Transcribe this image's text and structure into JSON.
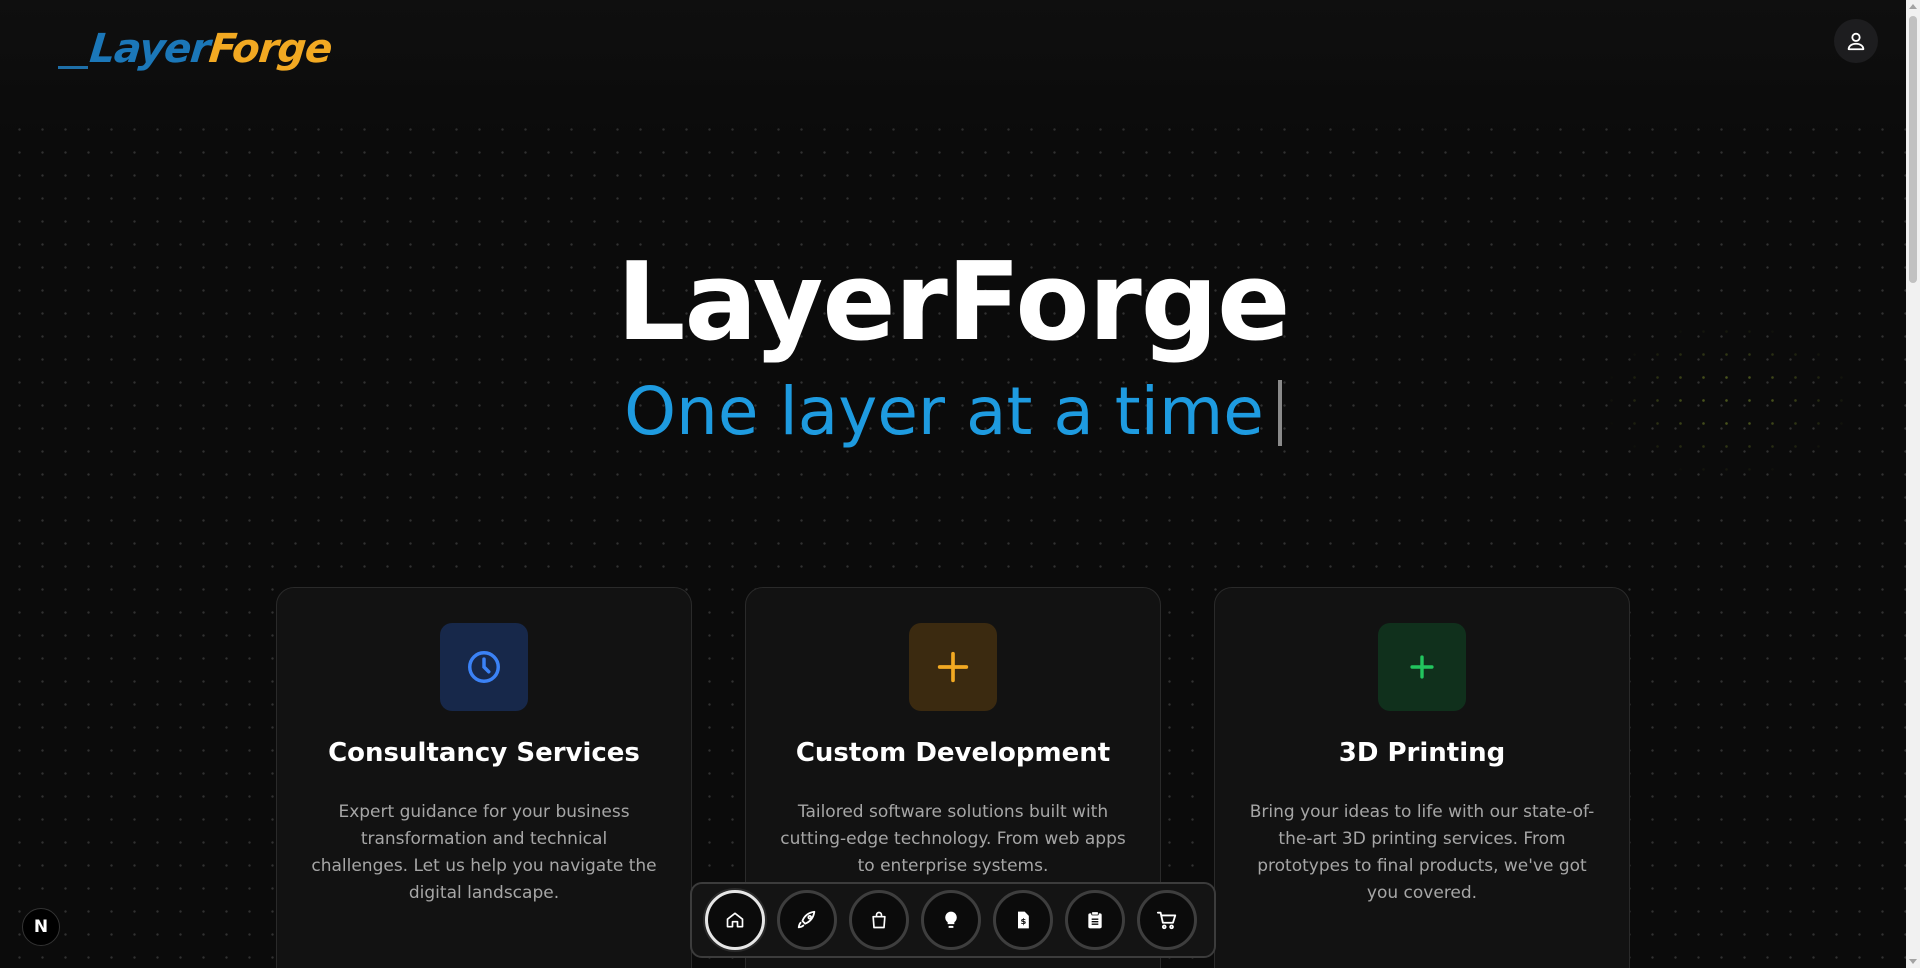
{
  "brand": {
    "logo_part1": "Layer",
    "logo_part2": "Forge"
  },
  "header": {
    "user_icon": "user-icon"
  },
  "hero": {
    "title": "LayerForge",
    "subtitle": "One layer at a time"
  },
  "colors": {
    "accent_blue": "#1e9be0",
    "accent_orange": "#f2a922",
    "accent_green": "#22c55e",
    "background": "#0b0b0b"
  },
  "services": [
    {
      "title": "Consultancy Services",
      "description": "Expert guidance for your business transformation and technical challenges. Let us help you navigate the digital landscape.",
      "icon": "clock-icon"
    },
    {
      "title": "Custom Development",
      "description": "Tailored software solutions built with cutting-edge technology. From web apps to enterprise systems.",
      "icon": "plus-icon"
    },
    {
      "title": "3D Printing",
      "description": "Bring your ideas to life with our state-of-the-art 3D printing services. From prototypes to final products, we've got you covered.",
      "icon": "plus-icon"
    }
  ],
  "dock": {
    "items": [
      "home-icon",
      "rocket-icon",
      "shopping-bag-icon",
      "lightbulb-icon",
      "invoice-icon",
      "clipboard-icon",
      "cart-icon"
    ],
    "active_index": 0
  },
  "badge": {
    "label": "N"
  }
}
